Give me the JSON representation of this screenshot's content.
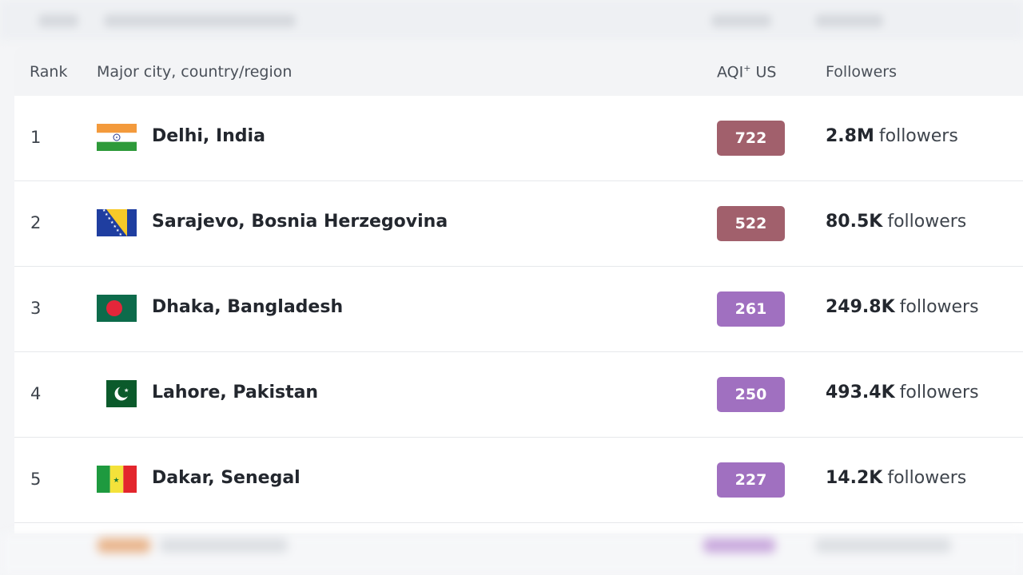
{
  "table": {
    "headers": {
      "rank": "Rank",
      "city": "Major city, country/region",
      "aqi": "AQI",
      "aqi_sup": "+",
      "aqi_unit": "US",
      "followers": "Followers"
    },
    "rows": [
      {
        "rank": "1",
        "city": "Delhi, India",
        "flag": "india-flag-icon",
        "aqi": "722",
        "aqi_color": "#a1606c",
        "followers": "2.8M",
        "followers_suffix": "followers"
      },
      {
        "rank": "2",
        "city": "Sarajevo, Bosnia Herzegovina",
        "flag": "bosnia-flag-icon",
        "aqi": "522",
        "aqi_color": "#a1606c",
        "followers": "80.5K",
        "followers_suffix": "followers"
      },
      {
        "rank": "3",
        "city": "Dhaka, Bangladesh",
        "flag": "bangladesh-flag-icon",
        "aqi": "261",
        "aqi_color": "#a070c0",
        "followers": "249.8K",
        "followers_suffix": "followers"
      },
      {
        "rank": "4",
        "city": "Lahore, Pakistan",
        "flag": "pakistan-flag-icon",
        "aqi": "250",
        "aqi_color": "#a070c0",
        "followers": "493.4K",
        "followers_suffix": "followers"
      },
      {
        "rank": "5",
        "city": "Dakar, Senegal",
        "flag": "senegal-flag-icon",
        "aqi": "227",
        "aqi_color": "#a070c0",
        "followers": "14.2K",
        "followers_suffix": "followers"
      }
    ]
  }
}
